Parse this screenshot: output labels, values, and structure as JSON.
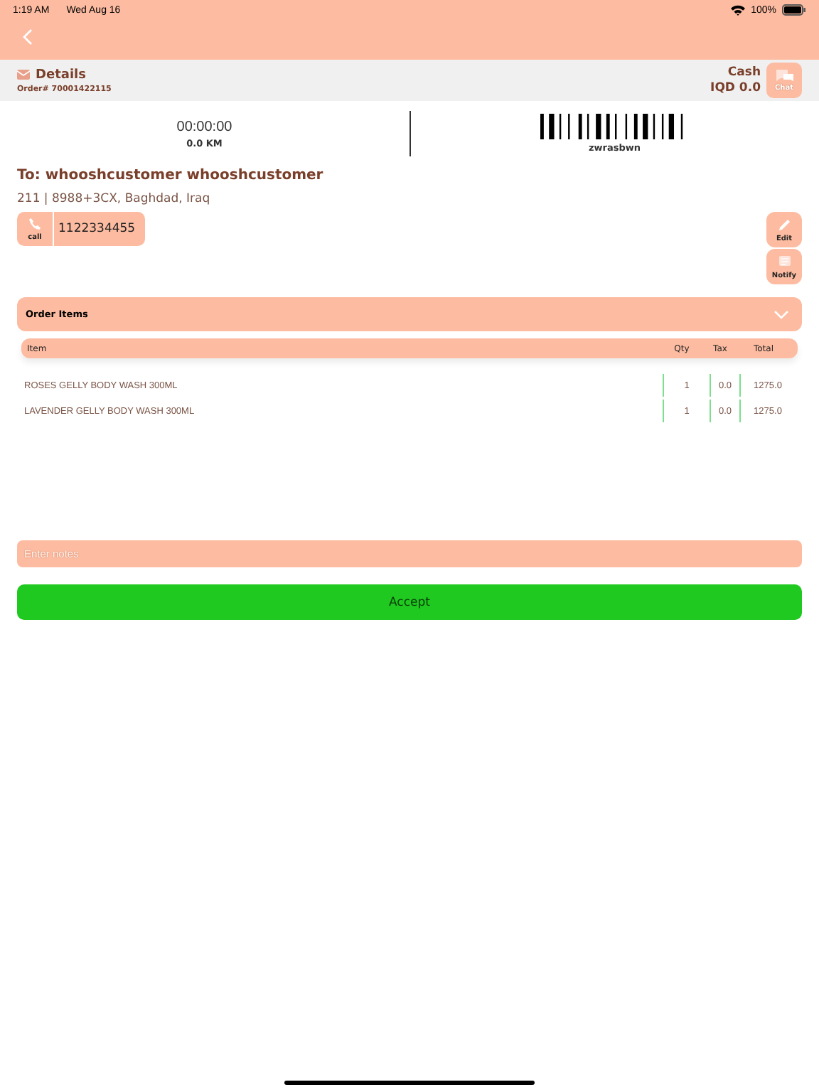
{
  "status_bar": {
    "time": "1:19 AM",
    "date": "Wed Aug 16",
    "battery": "100%"
  },
  "details": {
    "title": "Details",
    "order_number": "Order# 70001422115",
    "payment": "Cash",
    "amount": "IQD 0.0",
    "chat_label": "Chat"
  },
  "tracking": {
    "timer": "00:00:00",
    "distance": "0.0 KM",
    "barcode_text": "zwrasbwn"
  },
  "customer": {
    "name": "To: whooshcustomer whooshcustomer",
    "address": "211 | 8988+3CX, Baghdad, Iraq",
    "call_label": "call",
    "phone": "1122334455"
  },
  "actions": [
    {
      "label": "Edit",
      "kind": "edit"
    },
    {
      "label": "Notify",
      "kind": "notify"
    }
  ],
  "order_items": {
    "title": "Order Items",
    "expanded": true,
    "columns": [
      "Item",
      "Qty",
      "Tax",
      "Total"
    ],
    "rows": [
      {
        "item": "ROSES GELLY BODY WASH 300ML",
        "qty": "1",
        "tax": "0.0",
        "total": "1275.0"
      },
      {
        "item": "LAVENDER GELLY BODY WASH 300ML",
        "qty": "1",
        "tax": "0.0",
        "total": "1275.0"
      }
    ]
  },
  "notes": {
    "placeholder": "Enter notes"
  },
  "accept_button": "Accept"
}
